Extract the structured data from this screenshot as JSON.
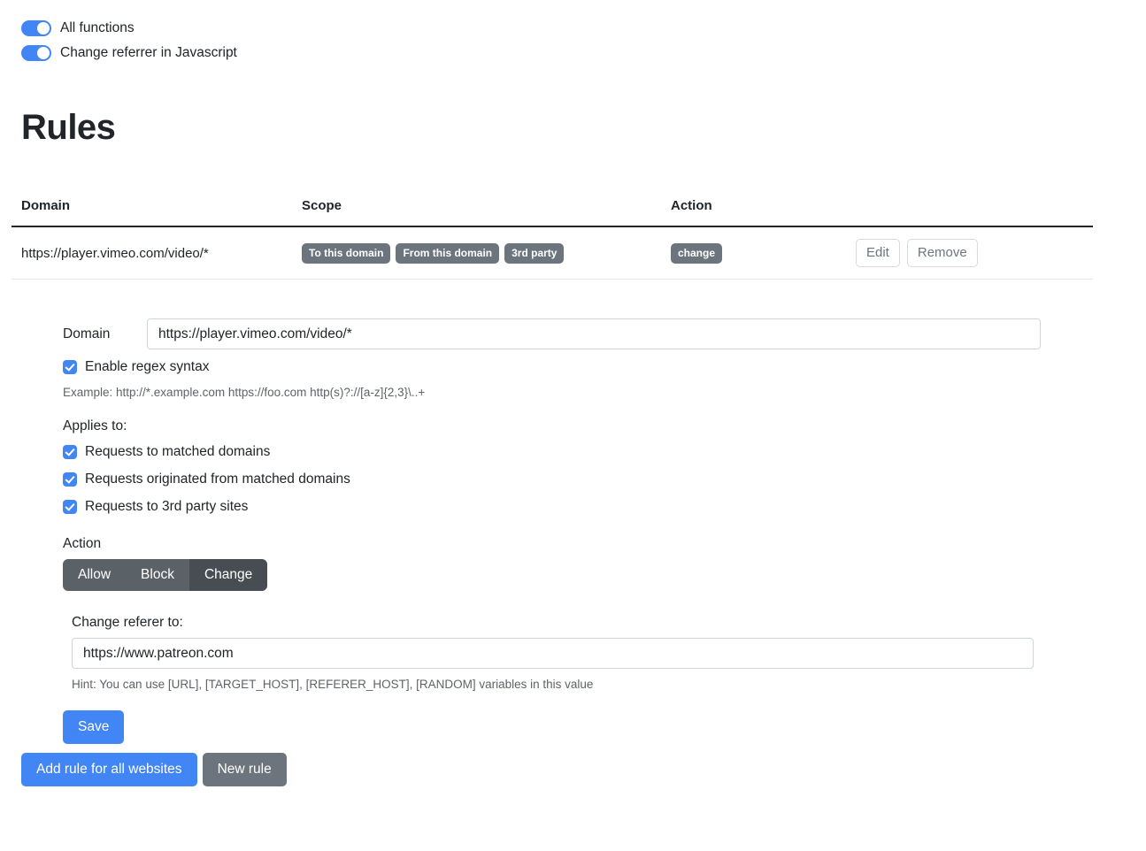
{
  "toggles": [
    {
      "label": "All functions",
      "on": true
    },
    {
      "label": "Change referrer in Javascript",
      "on": true
    }
  ],
  "page_title": "Rules",
  "table": {
    "headers": {
      "domain": "Domain",
      "scope": "Scope",
      "action": "Action",
      "tools": ""
    },
    "rows": [
      {
        "domain": "https://player.vimeo.com/video/*",
        "scope_badges": [
          "To this domain",
          "From this domain",
          "3rd party"
        ],
        "action_badge": "change",
        "edit_label": "Edit",
        "remove_label": "Remove"
      }
    ]
  },
  "form": {
    "domain_label": "Domain",
    "domain_value": "https://player.vimeo.com/video/*",
    "regex_checkbox_label": "Enable regex syntax",
    "regex_checked": true,
    "example_text": "Example: http://*.example.com https://foo.com http(s)?://[a-z]{2,3}\\..+",
    "applies_to_label": "Applies to:",
    "applies_to": [
      {
        "label": "Requests to matched domains",
        "checked": true
      },
      {
        "label": "Requests originated from matched domains",
        "checked": true
      },
      {
        "label": "Requests to 3rd party sites",
        "checked": true
      }
    ],
    "action_label": "Action",
    "action_options": [
      "Allow",
      "Block",
      "Change"
    ],
    "action_selected": "Change",
    "referer_label": "Change referer to:",
    "referer_value": "https://www.patreon.com",
    "referer_hint": "Hint: You can use [URL], [TARGET_HOST], [REFERER_HOST], [RANDOM] variables in this value",
    "save_label": "Save"
  },
  "bottom": {
    "add_rule_all_label": "Add rule for all websites",
    "new_rule_label": "New rule"
  },
  "colors": {
    "accent_blue": "#4285f4",
    "badge_gray": "#6c757d",
    "segment_gray": "#5a6268",
    "segment_active": "#474d52"
  }
}
